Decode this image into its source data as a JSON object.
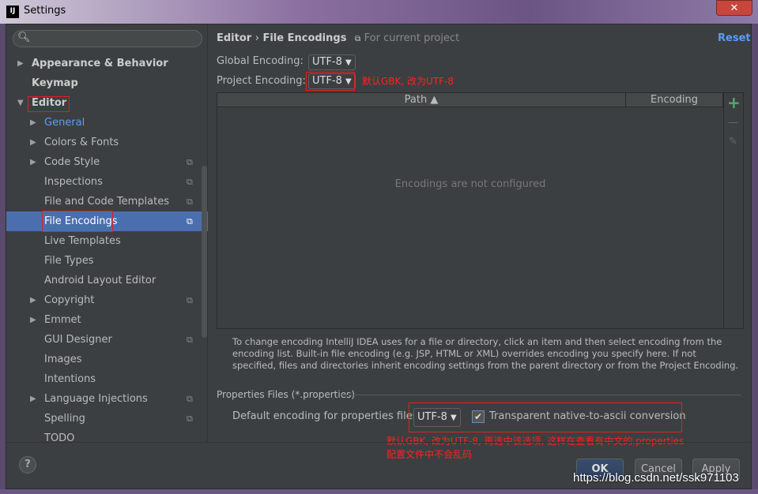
{
  "window": {
    "title": "Settings",
    "logo": "IJ",
    "close": "✕"
  },
  "sidebar": {
    "search_placeholder": "",
    "items": [
      {
        "label": "Appearance & Behavior",
        "arrow": "▶",
        "bold": true
      },
      {
        "label": "Keymap",
        "bold": true
      },
      {
        "label": "Editor",
        "arrow": "▼",
        "bold": true
      },
      {
        "label": "General",
        "arrow": "▶"
      },
      {
        "label": "Colors & Fonts",
        "arrow": "▶"
      },
      {
        "label": "Code Style",
        "arrow": "▶",
        "copy": true
      },
      {
        "label": "Inspections",
        "copy": true
      },
      {
        "label": "File and Code Templates",
        "copy": true
      },
      {
        "label": "File Encodings",
        "copy": true,
        "selected": true
      },
      {
        "label": "Live Templates"
      },
      {
        "label": "File Types"
      },
      {
        "label": "Android Layout Editor"
      },
      {
        "label": "Copyright",
        "arrow": "▶",
        "copy": true
      },
      {
        "label": "Emmet",
        "arrow": "▶"
      },
      {
        "label": "GUI Designer",
        "copy": true
      },
      {
        "label": "Images"
      },
      {
        "label": "Intentions"
      },
      {
        "label": "Language Injections",
        "arrow": "▶",
        "copy": true
      },
      {
        "label": "Spelling",
        "copy": true
      },
      {
        "label": "TODO"
      }
    ]
  },
  "header": {
    "crumb1": "Editor",
    "sep": "›",
    "crumb2": "File Encodings",
    "scope": "For current project",
    "reset": "Reset"
  },
  "global_encoding": {
    "label": "Global Encoding:",
    "value": "UTF-8"
  },
  "project_encoding": {
    "label": "Project Encoding:",
    "value": "UTF-8",
    "annotation": "默认GBK, 改为UTF-8"
  },
  "table": {
    "col_path": "Path ▲",
    "col_encoding": "Encoding",
    "empty": "Encodings are not configured",
    "add": "+",
    "remove": "—",
    "edit": "✎"
  },
  "help_text": "To change encoding IntelliJ IDEA uses for a file or directory, click an item and then select encoding from the encoding list. Built-in file encoding (e.g. JSP, HTML or XML) overrides encoding you specify here. If not specified, files and directories inherit encoding settings from the parent directory or from the Project Encoding.",
  "properties": {
    "section": "Properties Files (*.properties)",
    "label": "Default encoding for properties files:",
    "value": "UTF-8",
    "checkbox": "Transparent native-to-ascii conversion",
    "checked": true,
    "annotation1": "默认GBK, 改为UTF-8, 再选中该选项, 这样在查看有中文的.properties",
    "annotation2": "配置文件中不会乱码"
  },
  "footer": {
    "help": "?",
    "ok": "OK",
    "cancel": "Cancel",
    "apply": "Apply",
    "watermark": "https://blog.csdn.net/ssk971103"
  }
}
